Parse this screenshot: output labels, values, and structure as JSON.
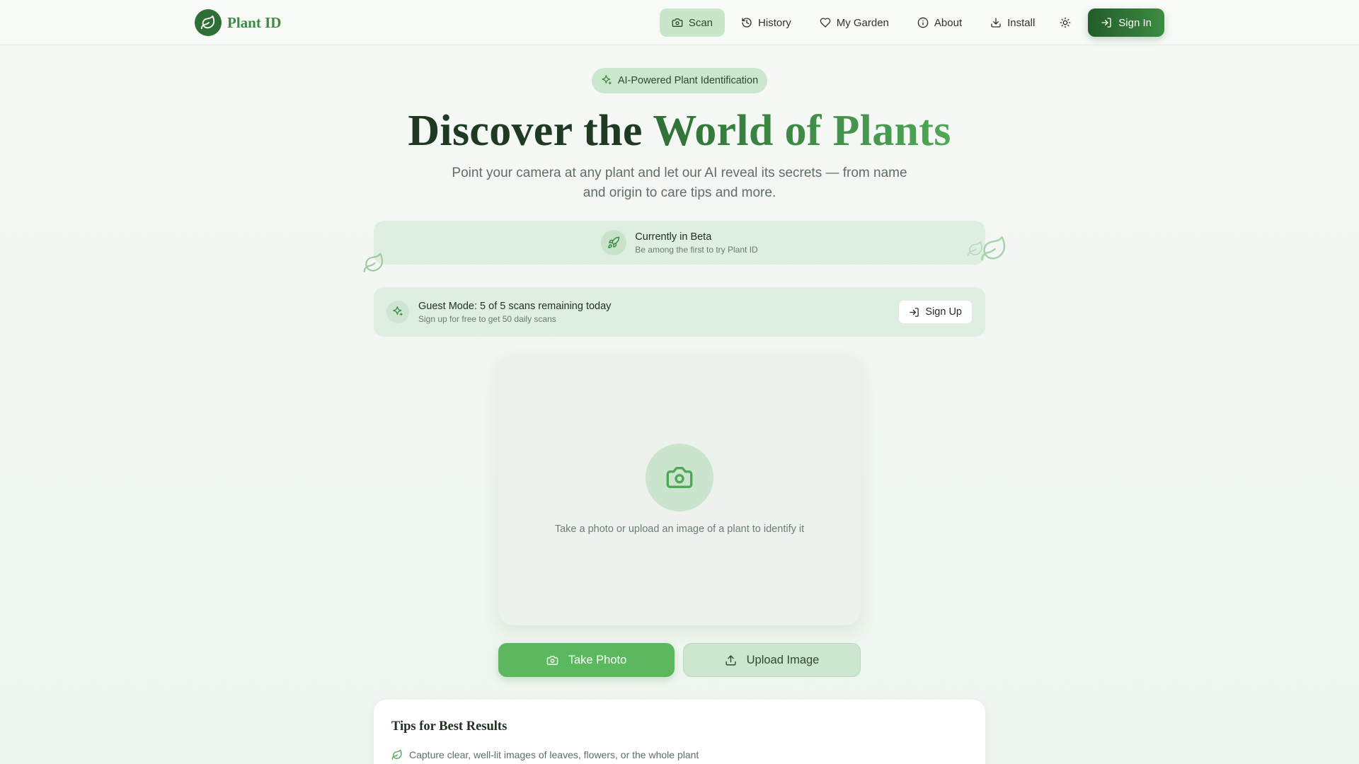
{
  "nav": {
    "brand": "Plant ID",
    "items": [
      {
        "label": "Scan",
        "icon": "camera-icon",
        "active": true
      },
      {
        "label": "History",
        "icon": "history-icon"
      },
      {
        "label": "My Garden",
        "icon": "heart-icon"
      },
      {
        "label": "About",
        "icon": "info-icon"
      },
      {
        "label": "Install",
        "icon": "download-icon"
      }
    ],
    "sign_in": "Sign In"
  },
  "hero": {
    "pill": "AI-Powered Plant Identification",
    "title_main": "Discover the ",
    "title_accent": "World of Plants",
    "subtitle": "Point your camera at any plant and let our AI reveal its secrets — from name and origin to care tips and more."
  },
  "beta": {
    "title": "Currently in Beta",
    "desc": "Be among the first to try Plant ID"
  },
  "guest": {
    "title": "Guest Mode: 5 of 5 scans remaining today",
    "desc": "Sign up for free to get 50 daily scans",
    "signup": "Sign Up"
  },
  "scan": {
    "hint": "Take a photo or upload an image of a plant to identify it"
  },
  "actions": {
    "take_photo": "Take Photo",
    "upload_image": "Upload Image"
  },
  "tips": {
    "title": "Tips for Best Results",
    "items": [
      "Capture clear, well-lit images of leaves, flowers, or the whole plant"
    ]
  },
  "colors": {
    "brand_dark": "#2f6f36",
    "brand_accent": "#4fa857",
    "primary_button": "#5cb85f",
    "soft_green": "#cbe7cd"
  }
}
